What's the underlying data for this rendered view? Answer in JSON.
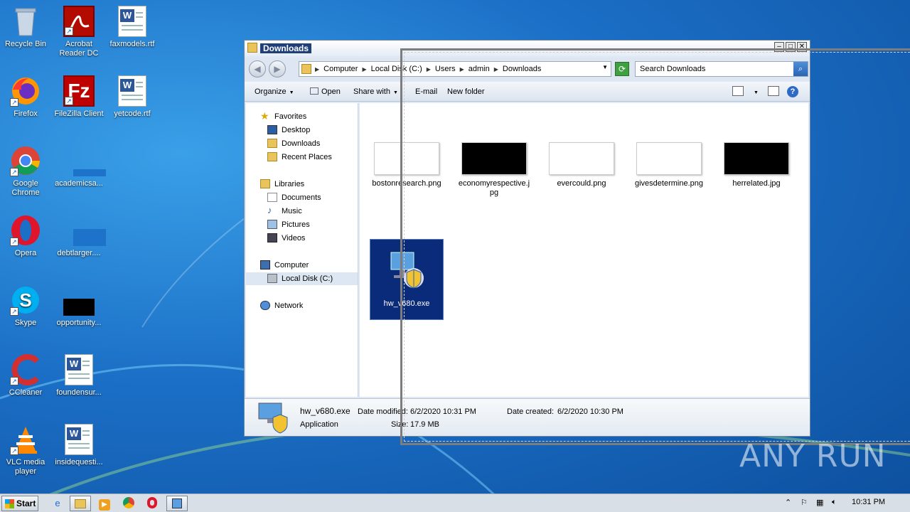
{
  "desktop": {
    "icons": [
      {
        "label": "Recycle Bin",
        "icon": "recycle-bin-icon"
      },
      {
        "label": "Acrobat Reader DC",
        "icon": "acrobat-icon"
      },
      {
        "label": "faxmodels.rtf",
        "icon": "word-doc-icon"
      },
      {
        "label": "Firefox",
        "icon": "firefox-icon"
      },
      {
        "label": "FileZilla Client",
        "icon": "filezilla-icon"
      },
      {
        "label": "yetcode.rtf",
        "icon": "word-doc-icon"
      },
      {
        "label": "Google Chrome",
        "icon": "chrome-icon"
      },
      {
        "label": "academicsa...",
        "icon": "blank-file-icon"
      },
      {
        "label": "Opera",
        "icon": "opera-icon"
      },
      {
        "label": "debtlarger....",
        "icon": "blank-file-icon"
      },
      {
        "label": "Skype",
        "icon": "skype-icon"
      },
      {
        "label": "opportunity...",
        "icon": "black-image-icon"
      },
      {
        "label": "CCleaner",
        "icon": "ccleaner-icon"
      },
      {
        "label": "foundensur...",
        "icon": "word-doc-icon"
      },
      {
        "label": "VLC media player",
        "icon": "vlc-icon"
      },
      {
        "label": "insidequesti...",
        "icon": "word-doc-icon"
      }
    ]
  },
  "window": {
    "title": "Downloads",
    "address": [
      "Computer",
      "Local Disk (C:)",
      "Users",
      "admin",
      "Downloads"
    ],
    "search_placeholder": "Search Downloads",
    "commands": {
      "organize": "Organize",
      "open": "Open",
      "share_with": "Share with",
      "email": "E-mail",
      "new_folder": "New folder"
    },
    "nav": {
      "favorites": "Favorites",
      "desktop": "Desktop",
      "downloads": "Downloads",
      "recent": "Recent Places",
      "libraries": "Libraries",
      "documents": "Documents",
      "music": "Music",
      "pictures": "Pictures",
      "videos": "Videos",
      "computer": "Computer",
      "local_disk": "Local Disk (C:)",
      "network": "Network"
    },
    "files": [
      {
        "name": "bostonresearch.png",
        "thumb": "#ffffff"
      },
      {
        "name": "economyrespective.jpg",
        "thumb": "#000000"
      },
      {
        "name": "evercould.png",
        "thumb": "#ffffff"
      },
      {
        "name": "givesdetermine.png",
        "thumb": "#ffffff"
      },
      {
        "name": "herrelated.jpg",
        "thumb": "#000000"
      },
      {
        "name": "hw_v680.exe",
        "thumb": "installer"
      }
    ],
    "details": {
      "name": "hw_v680.exe",
      "type": "Application",
      "modified_label": "Date modified:",
      "modified": "6/2/2020 10:31 PM",
      "created_label": "Date created:",
      "created": "6/2/2020 10:30 PM",
      "size_label": "Size:",
      "size": "17.9 MB"
    }
  },
  "taskbar": {
    "start": "Start",
    "clock": "10:31 PM"
  },
  "watermark": "ANY RUN"
}
